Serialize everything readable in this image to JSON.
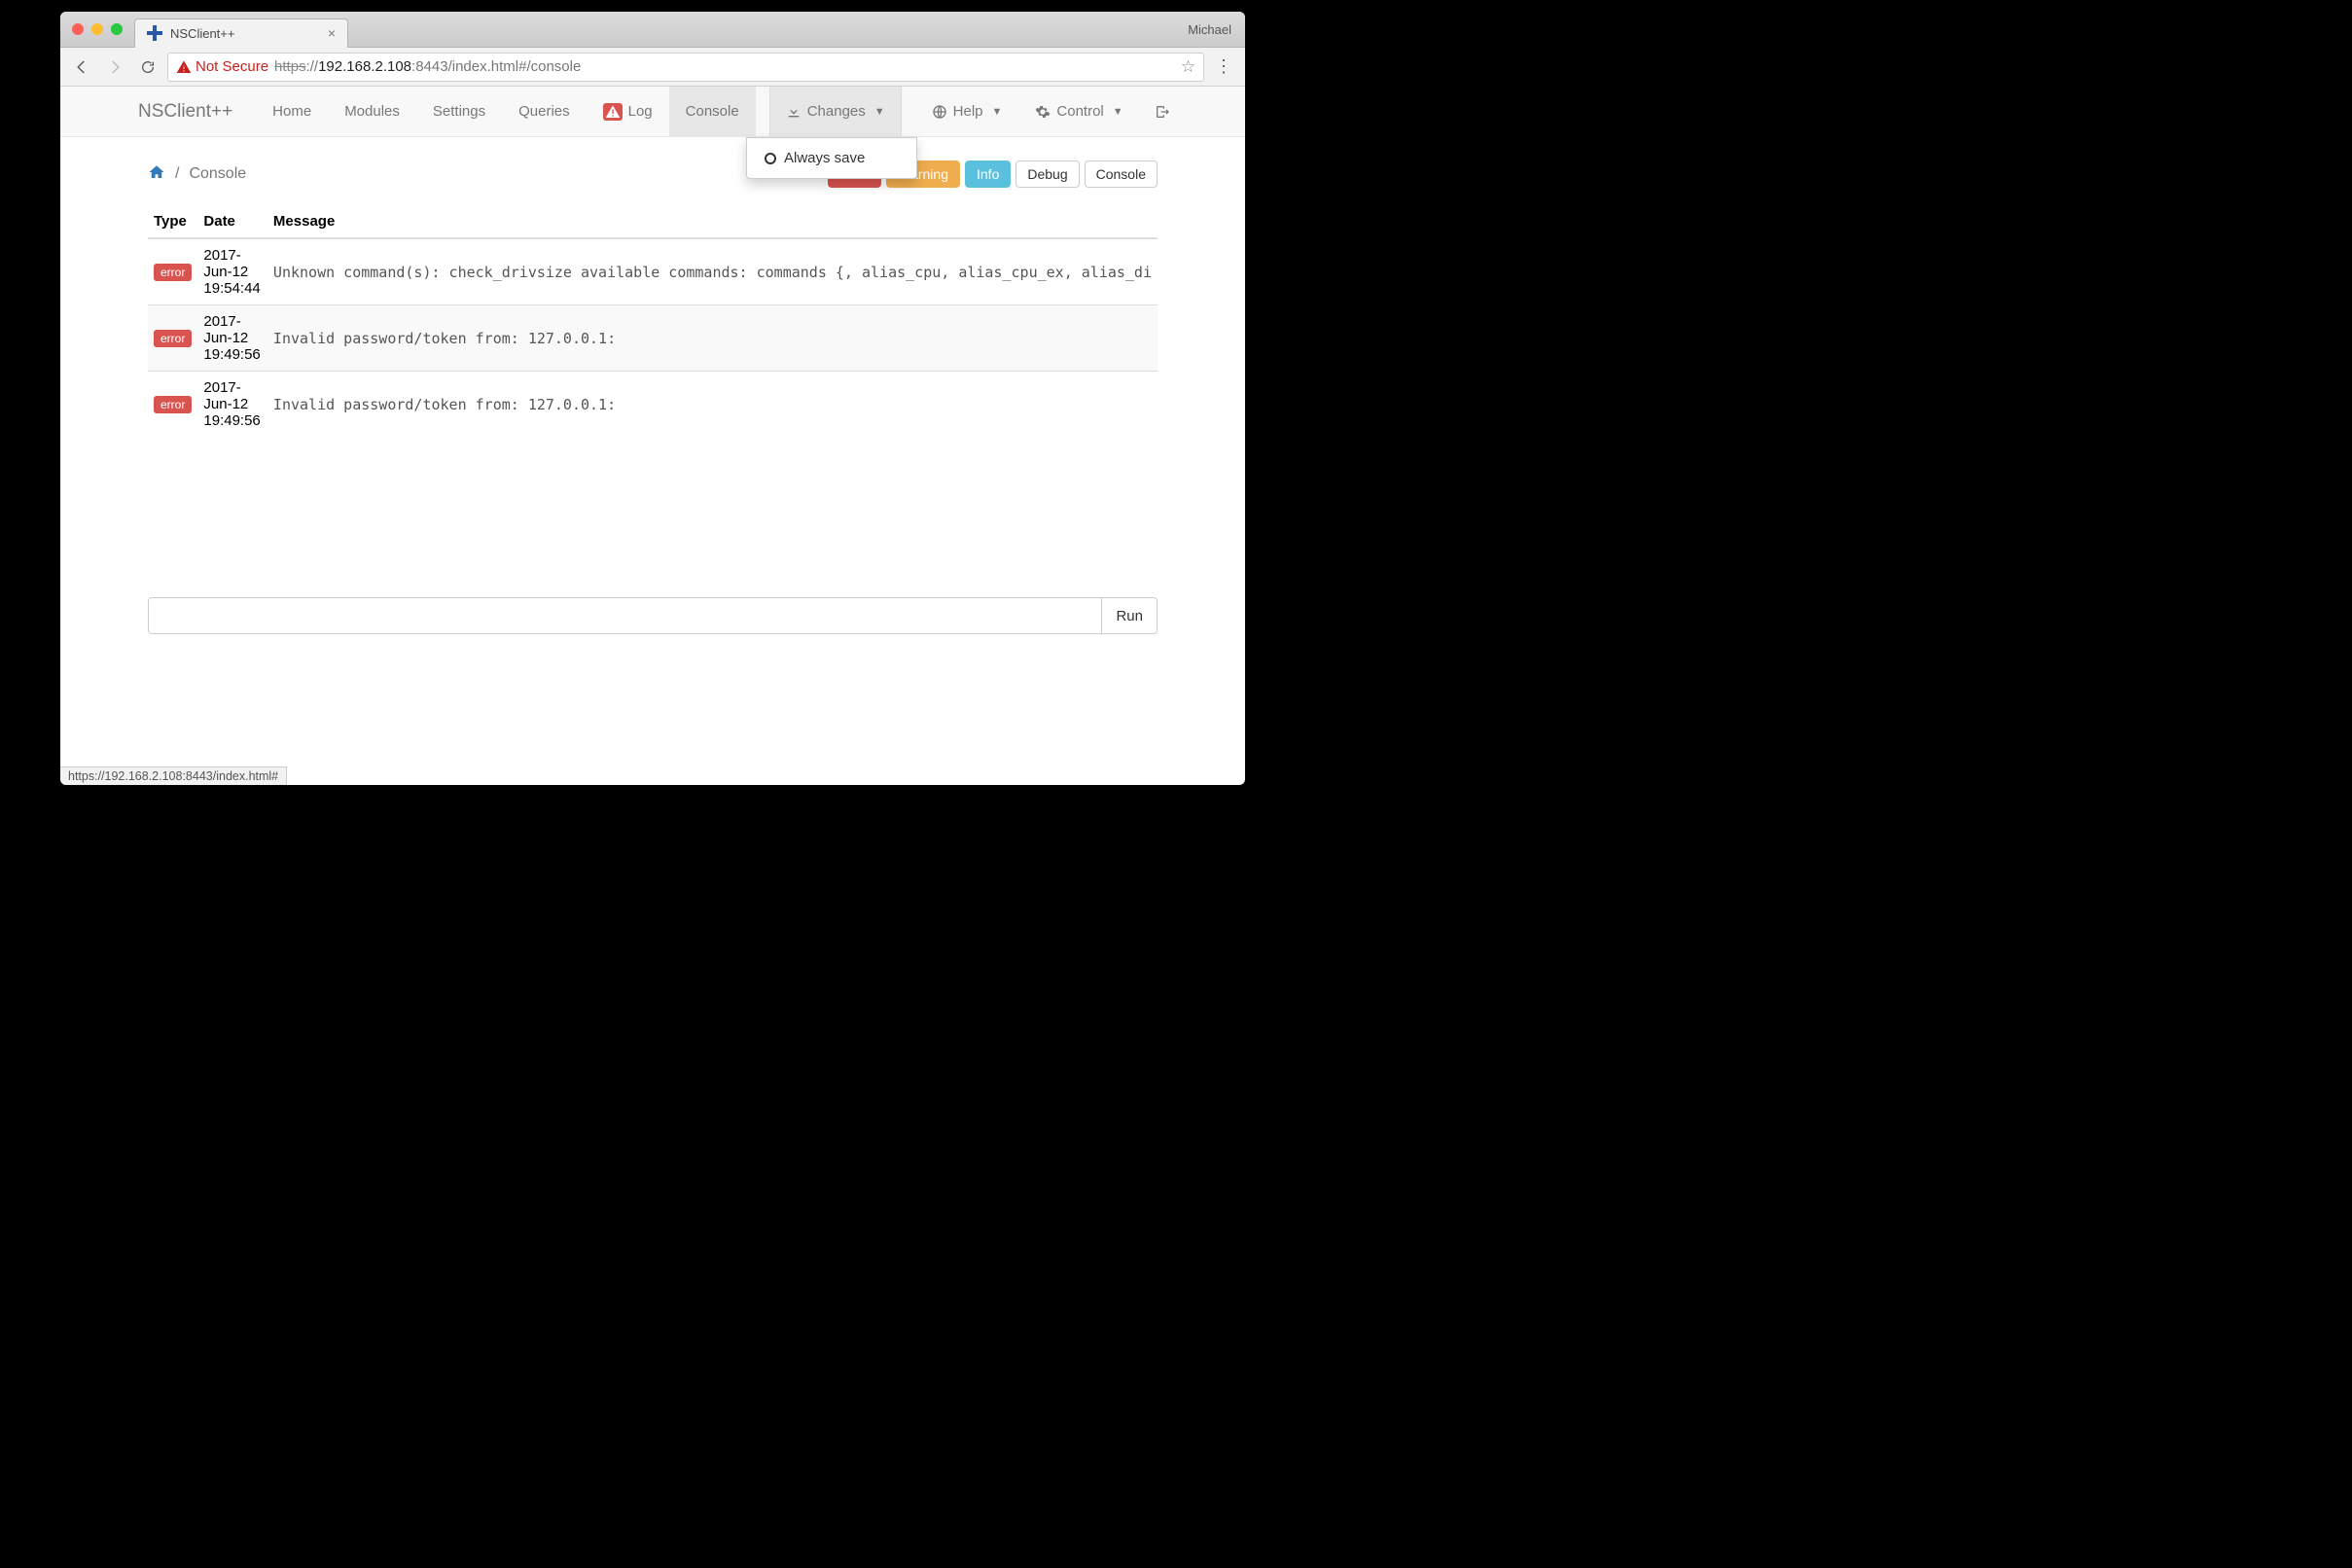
{
  "browser": {
    "profile": "Michael",
    "tab_title": "NSClient++",
    "security_label": "Not Secure",
    "url_scheme": "https",
    "url_host": "192.168.2.108",
    "url_port_path": ":8443/index.html#/console",
    "status_url": "https://192.168.2.108:8443/index.html#"
  },
  "nav": {
    "brand": "NSClient++",
    "home": "Home",
    "modules": "Modules",
    "settings": "Settings",
    "queries": "Queries",
    "log": "Log",
    "console": "Console",
    "changes": "Changes",
    "help": "Help",
    "control": "Control"
  },
  "dropdown": {
    "always_save": "Always save"
  },
  "breadcrumb": {
    "page": "Console"
  },
  "filters": {
    "error": "Error",
    "warning": "Warning",
    "info": "Info",
    "debug": "Debug",
    "console": "Console"
  },
  "table": {
    "col_type": "Type",
    "col_date": "Date",
    "col_message": "Message",
    "rows": [
      {
        "type": "error",
        "date": "2017-Jun-12 19:54:44",
        "message": "Unknown command(s): check_drivsize available commands: commands {, alias_cpu, alias_cpu_ex, alias_di"
      },
      {
        "type": "error",
        "date": "2017-Jun-12 19:49:56",
        "message": "Invalid password/token from: 127.0.0.1:"
      },
      {
        "type": "error",
        "date": "2017-Jun-12 19:49:56",
        "message": "Invalid password/token from: 127.0.0.1:"
      }
    ]
  },
  "runbar": {
    "run": "Run"
  }
}
